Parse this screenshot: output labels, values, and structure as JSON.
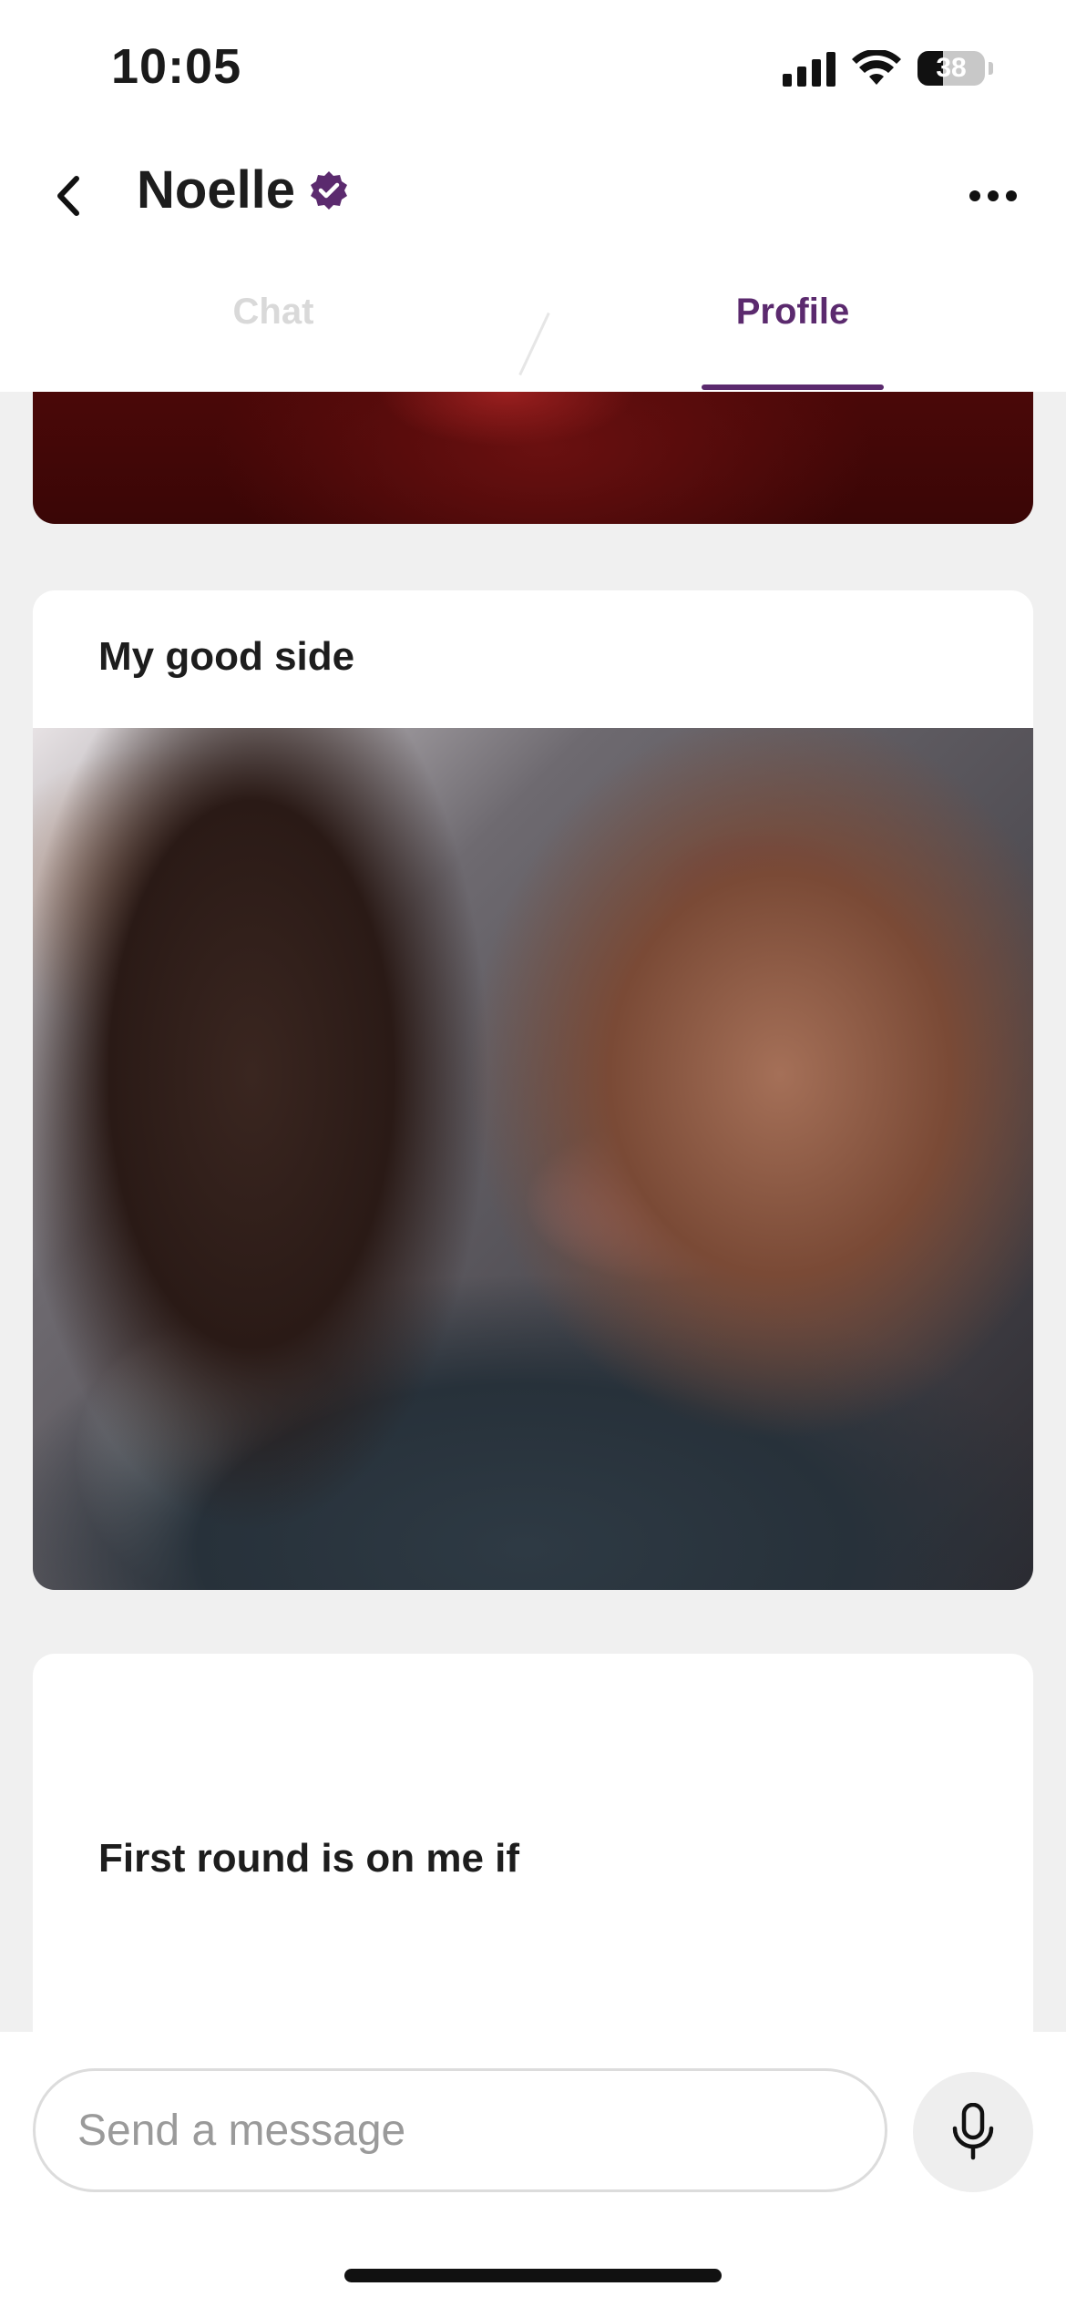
{
  "status_bar": {
    "time": "10:05",
    "battery": "38",
    "icons": [
      "cellular-signal-icon",
      "wifi-icon",
      "battery-icon"
    ]
  },
  "header": {
    "title": "Noelle",
    "verified_badge": "verified-badge-icon",
    "accent_color": "#5b2a6e"
  },
  "tabs": [
    {
      "label": "Chat",
      "active": false
    },
    {
      "label": "Profile",
      "active": true
    }
  ],
  "profile": {
    "cards": [
      {
        "title": "My good side"
      },
      {
        "prompt": "First round is on me if"
      }
    ]
  },
  "composer": {
    "placeholder": "Send a message",
    "mic_icon": "microphone-icon"
  }
}
